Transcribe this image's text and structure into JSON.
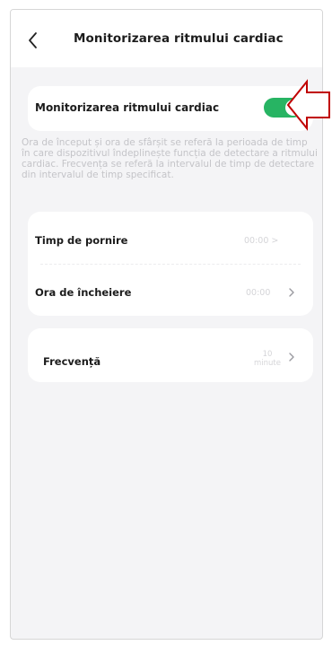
{
  "header": {
    "back_icon": "chevron-left-icon",
    "title": "Monitorizarea ritmului cardiac"
  },
  "toggle_card": {
    "label": "Monitorizarea ritmului cardiac",
    "enabled": true,
    "accent_color": "#27b463"
  },
  "description": "Ora de început și ora de sfârșit se referă la perioada de timp în care dispozitivul îndeplinește funcția de detectare a ritmului cardiac. Frecvența se referă la intervalul de timp de detectare din intervalul de timp specificat.",
  "times": {
    "start_label": "Timp de pornire",
    "start_value": "00:00 >",
    "end_label": "Ora de încheiere",
    "end_value": "00:00",
    "end_chevron_icon": "chevron-right-icon"
  },
  "frequency": {
    "label": "Frecvență",
    "value_number": "10",
    "value_unit": "minute",
    "chevron_icon": "chevron-right-icon"
  },
  "annotation": {
    "icon": "red-arrow-icon",
    "color": "#c00000"
  }
}
